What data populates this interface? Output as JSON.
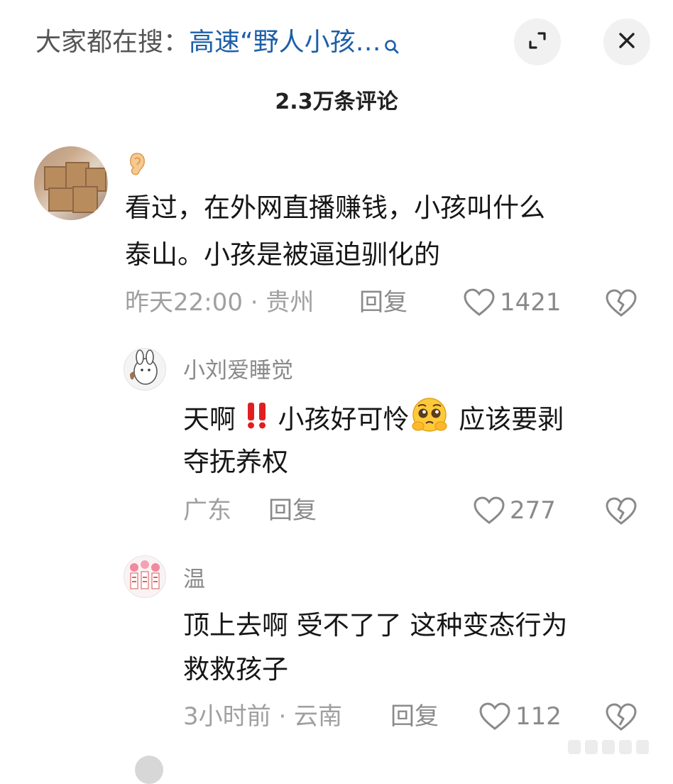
{
  "header": {
    "search_prefix": "大家都在搜：",
    "search_term": "高速“野人小孩…",
    "search_icon": "search-icon",
    "expand_icon": "expand-icon",
    "close_icon": "close-icon"
  },
  "comment_count": "2.3万条评论",
  "comments": [
    {
      "name": "",
      "name_icon": "ear-emoji",
      "line1": "看过，在外网直播赚钱，小孩叫什么",
      "line2": "泰山。小孩是被逼迫驯化的",
      "meta": "昨天22:00 · 贵州",
      "reply": "回复",
      "likes": "1421"
    },
    {
      "name": "小刘爱睡觉",
      "line1_a": "天啊 ",
      "line1_b": " 小孩好可怜",
      "line1_c": " 应该要剥",
      "line2": "夺抚养权",
      "meta": "广东",
      "reply": "回复",
      "likes": "277"
    },
    {
      "name": "温",
      "line1": "顶上去啊 受不了了 这种变态行为",
      "line2": "救救孩子",
      "meta": "3小时前 · 云南",
      "reply": "回复",
      "likes": "112"
    }
  ],
  "colors": {
    "link": "#1c5fa8",
    "muted": "#8a8a8a",
    "button_bg": "#f1f1f2"
  }
}
